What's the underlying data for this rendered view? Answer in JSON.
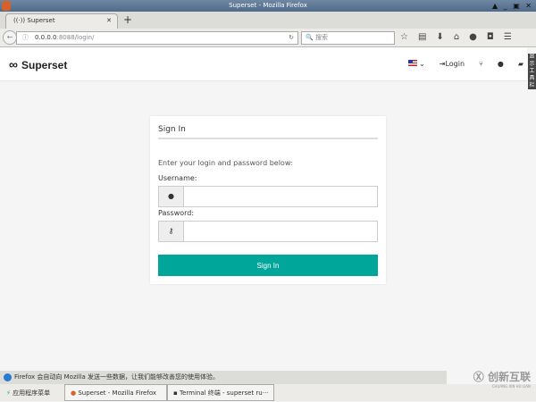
{
  "window": {
    "title": "Superset - Mozilla Firefox",
    "controls": "▲ _ ▣ ✕"
  },
  "tab": {
    "label": "Superset",
    "icon": "broadcast-icon",
    "close": "✕",
    "new": "+"
  },
  "navbar": {
    "url_host": "0.0.0.0",
    "url_rest": ":8088/login/",
    "search_placeholder": "搜索"
  },
  "header": {
    "brand": "Superset",
    "login": "Login",
    "side_toolbar": "显示工具栏"
  },
  "login": {
    "title": "Sign In",
    "prompt": "Enter your login and password below:",
    "username_label": "Username:",
    "password_label": "Password:",
    "button": "Sign In"
  },
  "notification": "Firefox 会自动向 Mozilla 发送一些数据，让我们能够改善您的使用体验。",
  "taskbar": {
    "menu": "应用程序菜单",
    "items": [
      "Superset - Mozilla Firefox",
      "Terminal 终端 - superset ru···"
    ]
  },
  "watermark": {
    "main": "创新互联",
    "sub": "CHUANG XIN HU LIAN"
  },
  "colors": {
    "accent": "#00a699"
  }
}
